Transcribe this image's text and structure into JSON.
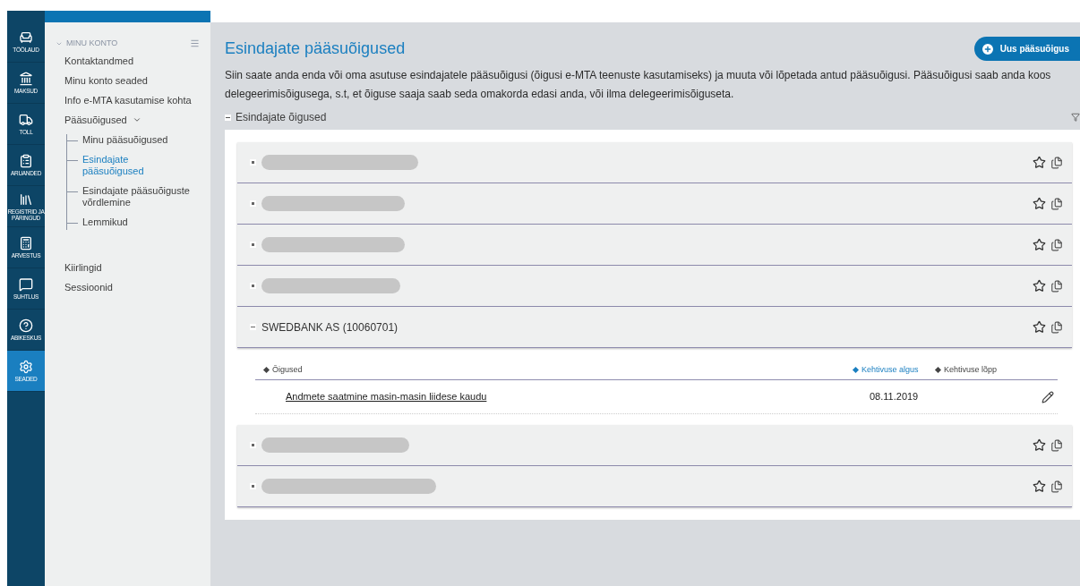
{
  "rail": [
    {
      "label": "TÖÖLAUD",
      "selected": false
    },
    {
      "label": "MAKSUD",
      "selected": false
    },
    {
      "label": "TOLL",
      "selected": false
    },
    {
      "label": "ARUANDED",
      "selected": false
    },
    {
      "label": "REGISTRID JA PÄRINGUD",
      "selected": false
    },
    {
      "label": "ARVESTUS",
      "selected": false
    },
    {
      "label": "SUHTLUS",
      "selected": false
    },
    {
      "label": "ABIKESKUS",
      "selected": false
    },
    {
      "label": "SEADED",
      "selected": true
    }
  ],
  "sidebar": {
    "section": "MINU KONTO",
    "expanded": true,
    "items": [
      {
        "label": "Kontaktandmed",
        "selected": false
      },
      {
        "label": "Minu konto seaded",
        "selected": false
      },
      {
        "label": "Info e-MTA kasutamise kohta",
        "selected": false
      },
      {
        "label": "Pääsuõigused",
        "selected": false,
        "expanded": true,
        "children": [
          {
            "label": "Minu pääsuõigused",
            "selected": false
          },
          {
            "label": "Esindajate pääsuõigused",
            "selected": true
          },
          {
            "label": "Esindajate pääsuõiguste võrdlemine",
            "selected": false
          },
          {
            "label": "Lemmikud",
            "selected": false
          }
        ]
      }
    ],
    "extra_items": [
      {
        "label": "Kiirlingid",
        "selected": false
      },
      {
        "label": "Sessioonid",
        "selected": false
      }
    ]
  },
  "page": {
    "title": "Esindajate pääsuõigused",
    "new_button": "Uus pääsuõigus",
    "description": "Siin saate anda enda või oma asutuse esindajatele pääsuõigusi (õigusi e-MTA teenuste kasutamiseks) ja muuta või lõpetada antud pääsuõigusi. Pääsuõigusi saab anda koos delegeerimisõigusega, s.t, et õiguse saaja saab seda omakorda edasi anda, või ilma delegeerimisõiguseta.",
    "section": {
      "title": "Esindajate õigused",
      "expanded": true
    }
  },
  "representatives": [
    {
      "kind": "redacted",
      "expanded": false
    },
    {
      "kind": "redacted",
      "expanded": false
    },
    {
      "kind": "redacted",
      "expanded": false
    },
    {
      "kind": "redacted",
      "expanded": false
    },
    {
      "kind": "named",
      "name": "SWEDBANK AS (10060701)",
      "expanded": true,
      "table": {
        "columns": [
          {
            "label": "Õigused",
            "selected": false
          },
          {
            "label": "Kehtivuse algus",
            "selected": true
          },
          {
            "label": "Kehtivuse lõpp",
            "selected": false
          }
        ],
        "rows": [
          {
            "right": "Andmete saatmine masin-masin liidese kaudu",
            "start": "08.11.2019"
          }
        ]
      }
    },
    {
      "kind": "redacted",
      "expanded": false
    },
    {
      "kind": "redacted",
      "expanded": false
    }
  ]
}
